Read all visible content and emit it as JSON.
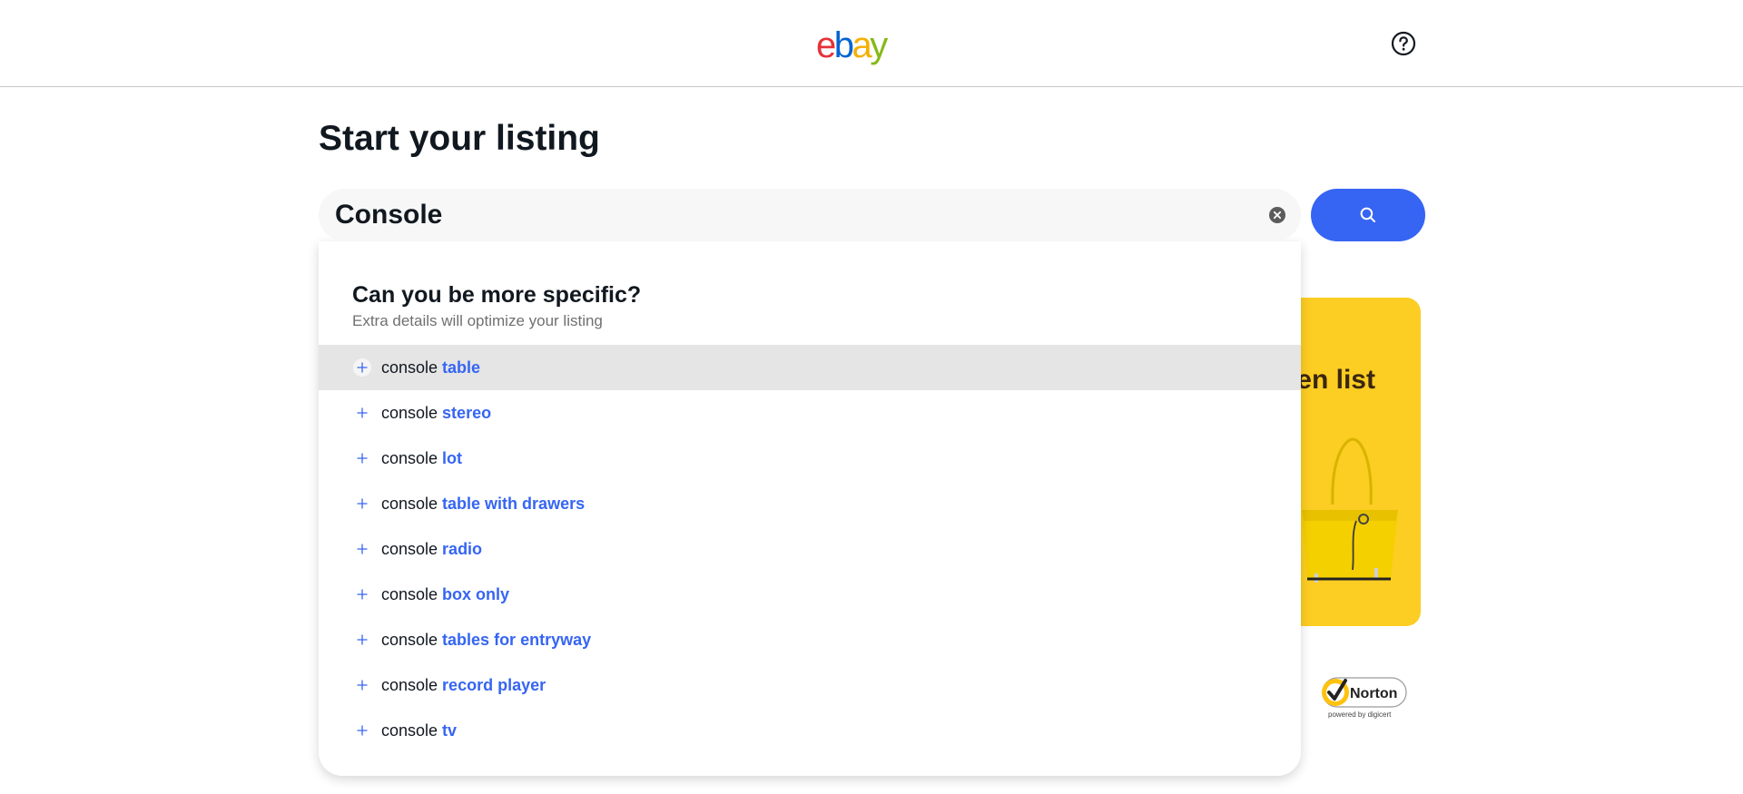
{
  "header": {
    "logo": {
      "e": "e",
      "b": "b",
      "a": "a",
      "y": "y",
      "colors": {
        "e": "#e53238",
        "b": "#0064d2",
        "a": "#f5af02",
        "y": "#86b817"
      }
    },
    "help_icon": "question-circle-icon"
  },
  "page": {
    "title": "Start your listing"
  },
  "search": {
    "value": "Console",
    "clear_icon": "clear-circle-icon",
    "button_icon": "search-icon",
    "button_color": "#3665f3"
  },
  "dropdown": {
    "title": "Can you be more specific?",
    "subtitle": "Extra details will optimize your listing",
    "suggestions": [
      {
        "base": "console ",
        "extra": "table",
        "highlighted": true
      },
      {
        "base": "console ",
        "extra": "stereo"
      },
      {
        "base": "console ",
        "extra": "lot"
      },
      {
        "base": "console ",
        "extra": "table with drawers"
      },
      {
        "base": "console ",
        "extra": "radio"
      },
      {
        "base": "console ",
        "extra": "box only"
      },
      {
        "base": "console ",
        "extra": "tables for entryway"
      },
      {
        "base": "console ",
        "extra": "record player"
      },
      {
        "base": "console ",
        "extra": "tv"
      }
    ]
  },
  "promo": {
    "visible_text": "en list",
    "background": "#fccd23",
    "image": "yellow-handbag"
  },
  "trust_badge": {
    "name": "Norton",
    "tagline": "powered by digicert"
  }
}
